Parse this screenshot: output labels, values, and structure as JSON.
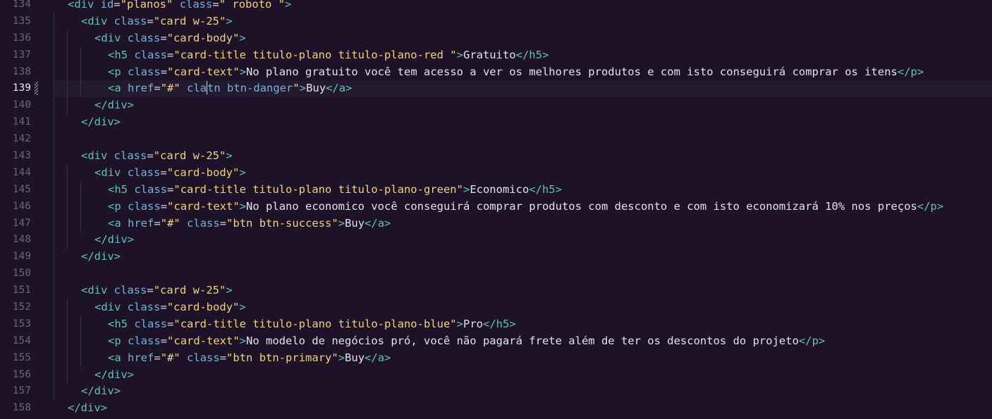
{
  "editor": {
    "lines": [
      {
        "num": "134",
        "indent": 0,
        "tokens": [
          [
            "tag",
            "<div"
          ],
          [
            "text",
            " "
          ],
          [
            "attr",
            "id"
          ],
          [
            "eq",
            "="
          ],
          [
            "str",
            "\"planos\""
          ],
          [
            "text",
            " "
          ],
          [
            "attr",
            "class"
          ],
          [
            "eq",
            "="
          ],
          [
            "str",
            "\" roboto \""
          ],
          [
            "tag",
            ">"
          ]
        ]
      },
      {
        "num": "135",
        "indent": 1,
        "tokens": [
          [
            "tag",
            "<div"
          ],
          [
            "text",
            " "
          ],
          [
            "attr",
            "class"
          ],
          [
            "eq",
            "="
          ],
          [
            "str",
            "\"card w-25\""
          ],
          [
            "tag",
            ">"
          ]
        ]
      },
      {
        "num": "136",
        "indent": 2,
        "tokens": [
          [
            "tag",
            "<div"
          ],
          [
            "text",
            " "
          ],
          [
            "attr",
            "class"
          ],
          [
            "eq",
            "="
          ],
          [
            "str",
            "\"card-body\""
          ],
          [
            "tag",
            ">"
          ]
        ]
      },
      {
        "num": "137",
        "indent": 3,
        "tokens": [
          [
            "tag",
            "<h5"
          ],
          [
            "text",
            " "
          ],
          [
            "attr",
            "class"
          ],
          [
            "eq",
            "="
          ],
          [
            "str",
            "\"card-title titulo-plano titulo-plano-red \""
          ],
          [
            "tag",
            ">"
          ],
          [
            "text",
            "Gratuito"
          ],
          [
            "tag",
            "</h5>"
          ]
        ]
      },
      {
        "num": "138",
        "indent": 3,
        "tokens": [
          [
            "tag",
            "<p"
          ],
          [
            "text",
            " "
          ],
          [
            "attr",
            "class"
          ],
          [
            "eq",
            "="
          ],
          [
            "str",
            "\"card-text\""
          ],
          [
            "tag",
            ">"
          ],
          [
            "text",
            "No plano gratuito você tem acesso a ver os melhores produtos e com isto conseguirá comprar os itens"
          ],
          [
            "tag",
            "</p>"
          ]
        ]
      },
      {
        "num": "139",
        "indent": 3,
        "active": true,
        "dirty": true,
        "tokens": [
          [
            "tag",
            "<a"
          ],
          [
            "text",
            " "
          ],
          [
            "attr",
            "href"
          ],
          [
            "eq",
            "="
          ],
          [
            "str",
            "\"#\""
          ],
          [
            "text",
            " "
          ],
          [
            "attr",
            "cla"
          ],
          [
            "cursor",
            ""
          ],
          [
            "attr",
            "tn"
          ],
          [
            "text",
            " "
          ],
          [
            "attr",
            "btn-danger"
          ],
          [
            "str",
            "\""
          ],
          [
            "tag",
            ">"
          ],
          [
            "text",
            "Buy"
          ],
          [
            "tag",
            "</a>"
          ]
        ]
      },
      {
        "num": "140",
        "indent": 2,
        "tokens": [
          [
            "tag",
            "</div>"
          ]
        ]
      },
      {
        "num": "141",
        "indent": 1,
        "tokens": [
          [
            "tag",
            "</div>"
          ]
        ]
      },
      {
        "num": "142",
        "indent": 1,
        "tokens": []
      },
      {
        "num": "143",
        "indent": 1,
        "tokens": [
          [
            "tag",
            "<div"
          ],
          [
            "text",
            " "
          ],
          [
            "attr",
            "class"
          ],
          [
            "eq",
            "="
          ],
          [
            "str",
            "\"card w-25\""
          ],
          [
            "tag",
            ">"
          ]
        ]
      },
      {
        "num": "144",
        "indent": 2,
        "tokens": [
          [
            "tag",
            "<div"
          ],
          [
            "text",
            " "
          ],
          [
            "attr",
            "class"
          ],
          [
            "eq",
            "="
          ],
          [
            "str",
            "\"card-body\""
          ],
          [
            "tag",
            ">"
          ]
        ]
      },
      {
        "num": "145",
        "indent": 3,
        "tokens": [
          [
            "tag",
            "<h5"
          ],
          [
            "text",
            " "
          ],
          [
            "attr",
            "class"
          ],
          [
            "eq",
            "="
          ],
          [
            "str",
            "\"card-title titulo-plano titulo-plano-green\""
          ],
          [
            "tag",
            ">"
          ],
          [
            "text",
            "Economico"
          ],
          [
            "tag",
            "</h5>"
          ]
        ]
      },
      {
        "num": "146",
        "indent": 3,
        "tokens": [
          [
            "tag",
            "<p"
          ],
          [
            "text",
            " "
          ],
          [
            "attr",
            "class"
          ],
          [
            "eq",
            "="
          ],
          [
            "str",
            "\"card-text\""
          ],
          [
            "tag",
            ">"
          ],
          [
            "text",
            "No plano economico você conseguirá comprar produtos com desconto e com isto economizará 10% nos preços"
          ],
          [
            "tag",
            "</p>"
          ]
        ]
      },
      {
        "num": "147",
        "indent": 3,
        "tokens": [
          [
            "tag",
            "<a"
          ],
          [
            "text",
            " "
          ],
          [
            "attr",
            "href"
          ],
          [
            "eq",
            "="
          ],
          [
            "str",
            "\"#\""
          ],
          [
            "text",
            " "
          ],
          [
            "attr",
            "class"
          ],
          [
            "eq",
            "="
          ],
          [
            "str",
            "\"btn btn-success\""
          ],
          [
            "tag",
            ">"
          ],
          [
            "text",
            "Buy"
          ],
          [
            "tag",
            "</a>"
          ]
        ]
      },
      {
        "num": "148",
        "indent": 2,
        "tokens": [
          [
            "tag",
            "</div>"
          ]
        ]
      },
      {
        "num": "149",
        "indent": 1,
        "tokens": [
          [
            "tag",
            "</div>"
          ]
        ]
      },
      {
        "num": "150",
        "indent": 1,
        "tokens": []
      },
      {
        "num": "151",
        "indent": 1,
        "tokens": [
          [
            "tag",
            "<div"
          ],
          [
            "text",
            " "
          ],
          [
            "attr",
            "class"
          ],
          [
            "eq",
            "="
          ],
          [
            "str",
            "\"card w-25\""
          ],
          [
            "tag",
            ">"
          ]
        ]
      },
      {
        "num": "152",
        "indent": 2,
        "tokens": [
          [
            "tag",
            "<div"
          ],
          [
            "text",
            " "
          ],
          [
            "attr",
            "class"
          ],
          [
            "eq",
            "="
          ],
          [
            "str",
            "\"card-body\""
          ],
          [
            "tag",
            ">"
          ]
        ]
      },
      {
        "num": "153",
        "indent": 3,
        "tokens": [
          [
            "tag",
            "<h5"
          ],
          [
            "text",
            " "
          ],
          [
            "attr",
            "class"
          ],
          [
            "eq",
            "="
          ],
          [
            "str",
            "\"card-title titulo-plano titulo-plano-blue\""
          ],
          [
            "tag",
            ">"
          ],
          [
            "text",
            "Pro"
          ],
          [
            "tag",
            "</h5>"
          ]
        ]
      },
      {
        "num": "154",
        "indent": 3,
        "tokens": [
          [
            "tag",
            "<p"
          ],
          [
            "text",
            " "
          ],
          [
            "attr",
            "class"
          ],
          [
            "eq",
            "="
          ],
          [
            "str",
            "\"card-text\""
          ],
          [
            "tag",
            ">"
          ],
          [
            "text",
            "No modelo de negócios pró, você não pagará frete além de ter os descontos do projeto"
          ],
          [
            "tag",
            "</p>"
          ]
        ]
      },
      {
        "num": "155",
        "indent": 3,
        "tokens": [
          [
            "tag",
            "<a"
          ],
          [
            "text",
            " "
          ],
          [
            "attr",
            "href"
          ],
          [
            "eq",
            "="
          ],
          [
            "str",
            "\"#\""
          ],
          [
            "text",
            " "
          ],
          [
            "attr",
            "class"
          ],
          [
            "eq",
            "="
          ],
          [
            "str",
            "\"btn btn-primary\""
          ],
          [
            "tag",
            ">"
          ],
          [
            "text",
            "Buy"
          ],
          [
            "tag",
            "</a>"
          ]
        ]
      },
      {
        "num": "156",
        "indent": 2,
        "tokens": [
          [
            "tag",
            "</div>"
          ]
        ]
      },
      {
        "num": "157",
        "indent": 1,
        "tokens": [
          [
            "tag",
            "</div>"
          ]
        ]
      },
      {
        "num": "158",
        "indent": 0,
        "tokens": [
          [
            "tag",
            "</div>"
          ]
        ]
      }
    ]
  }
}
